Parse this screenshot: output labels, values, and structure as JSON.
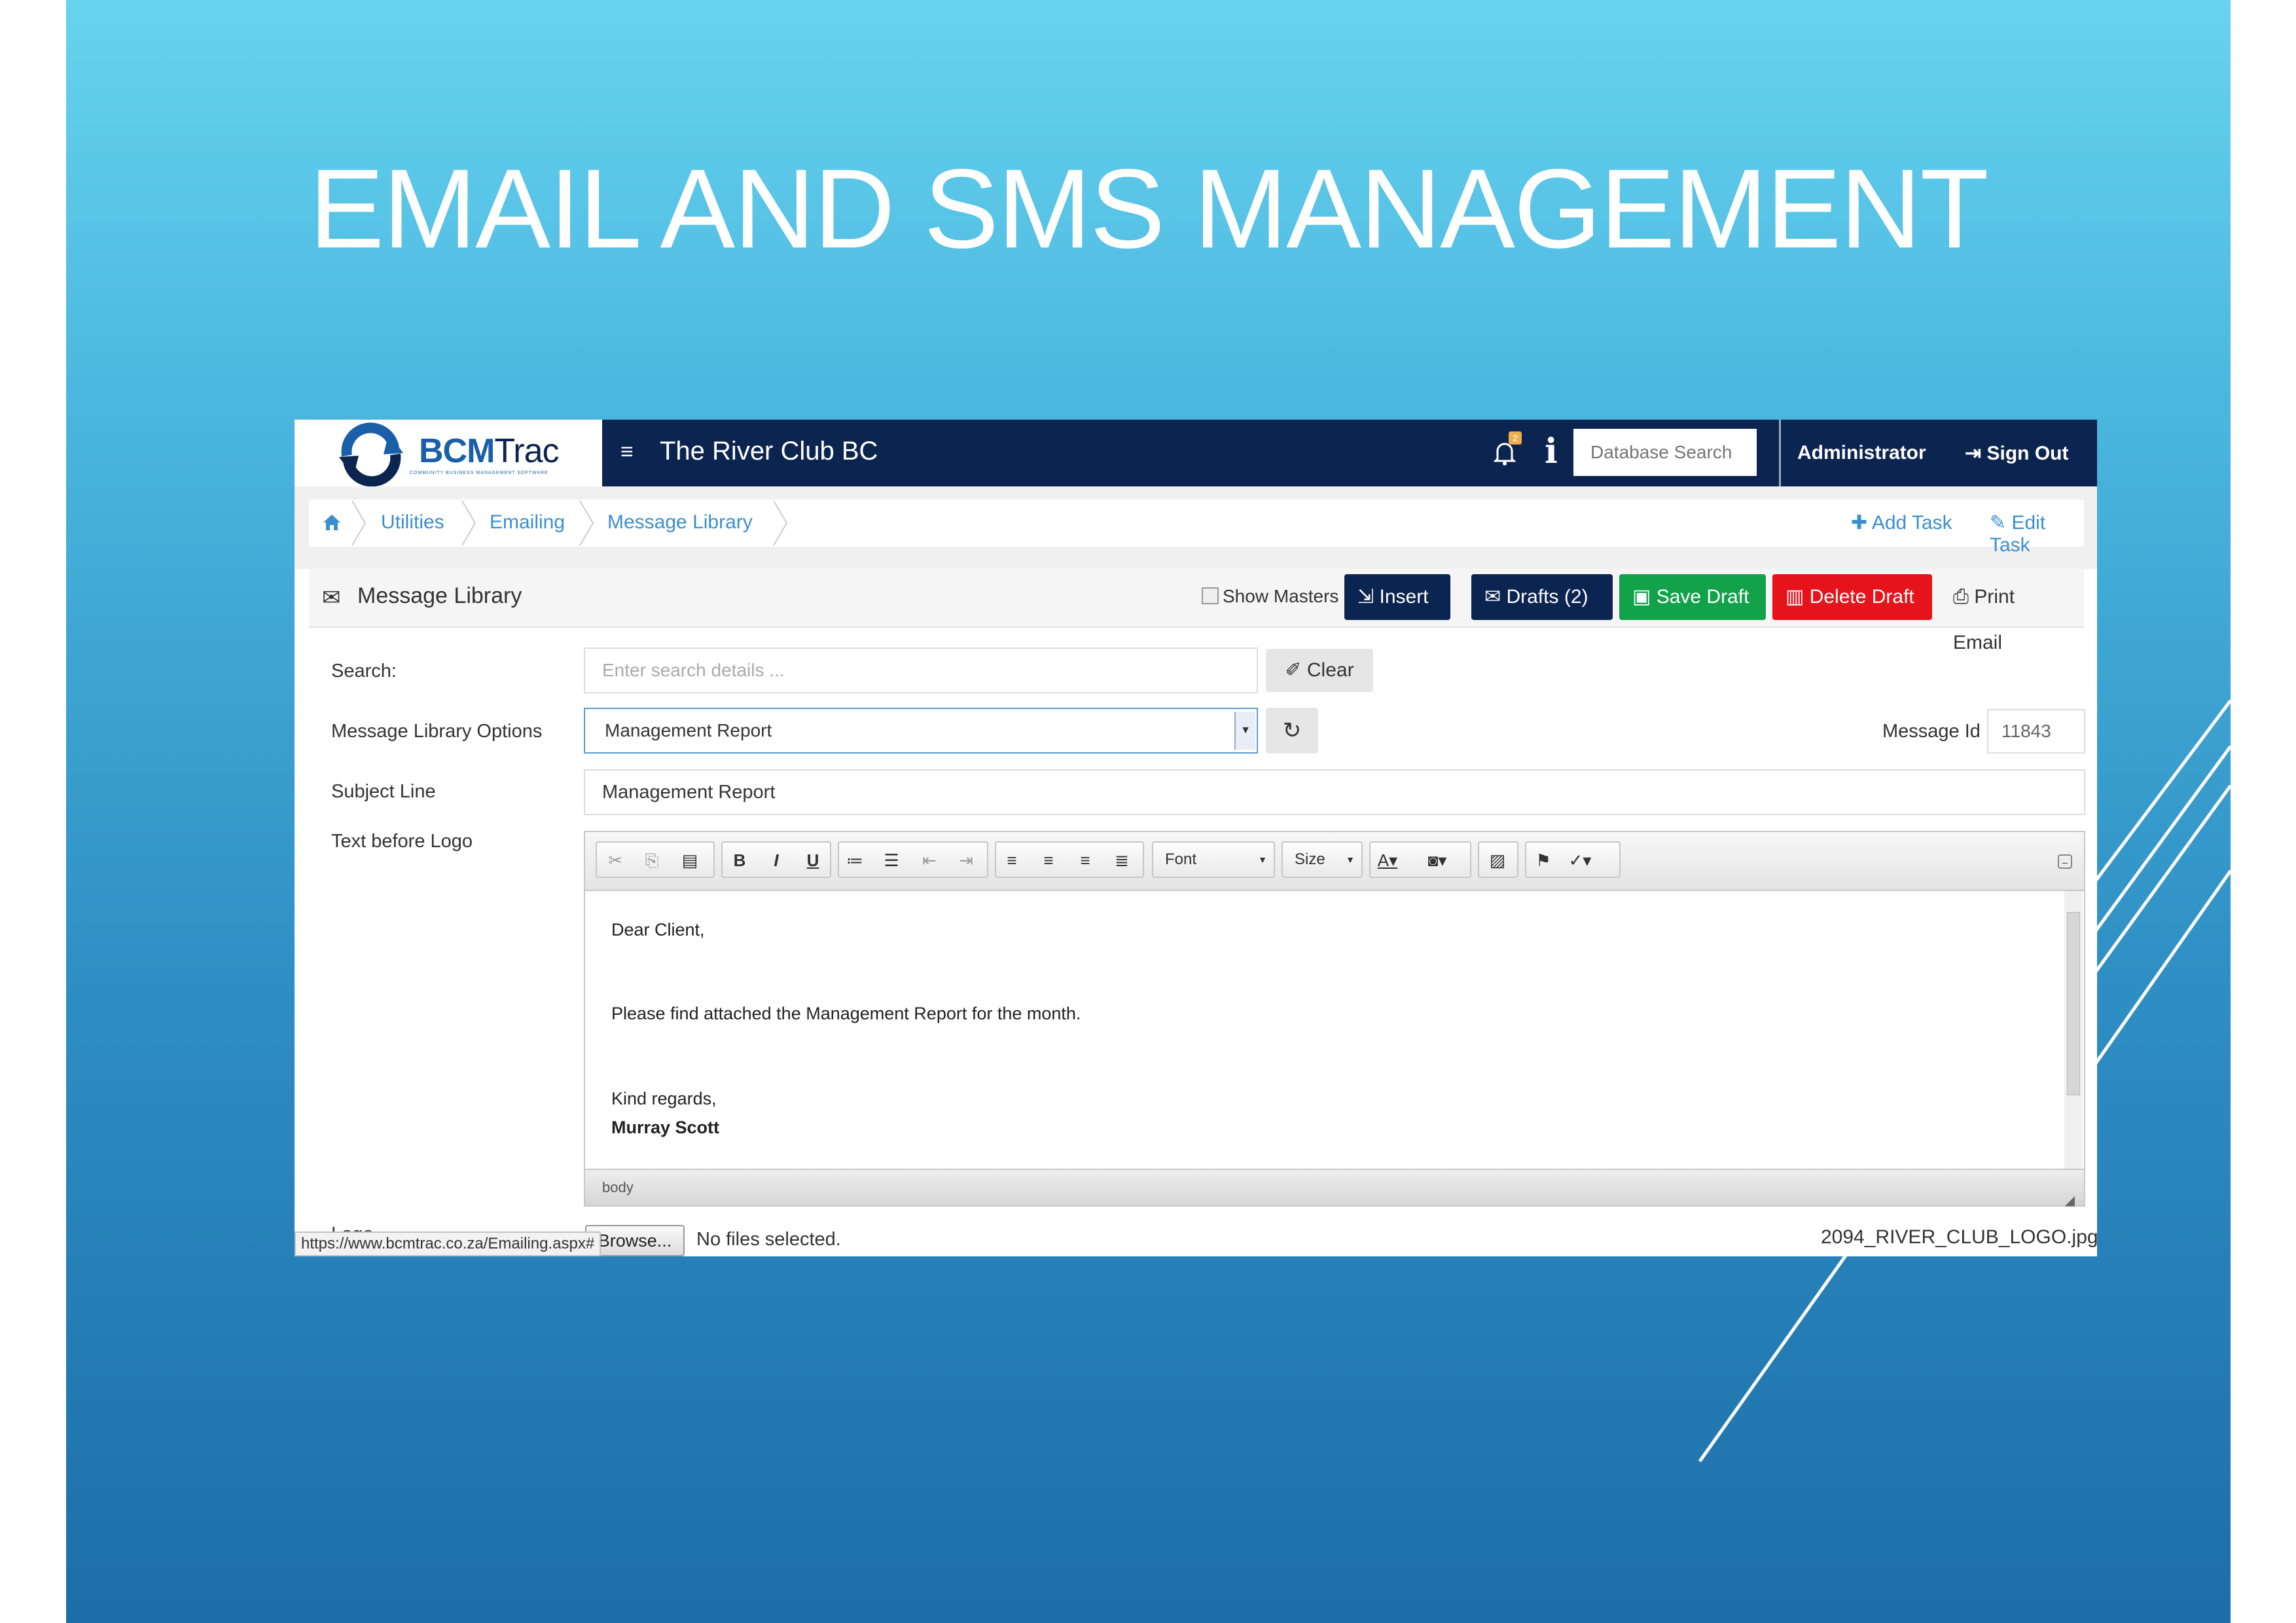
{
  "slide": {
    "title": "EMAIL AND SMS MANAGEMENT"
  },
  "app": {
    "logo_text_bold": "BCM",
    "logo_text_light": "Trac",
    "logo_tagline": "COMMUNITY BUSINESS MANAGEMENT SOFTWARE",
    "club_name": "The River Club BC",
    "notification_count": "2",
    "db_search_placeholder": "Database Search",
    "user": "Administrator",
    "signout_label": "Sign Out"
  },
  "breadcrumb": {
    "items": [
      "Utilities",
      "Emailing",
      "Message Library"
    ],
    "add_task": "Add Task",
    "edit_task": "Edit Task"
  },
  "panel": {
    "title": "Message Library",
    "show_masters": "Show Masters",
    "insert": "Insert",
    "drafts": "Drafts (2)",
    "save_draft": "Save Draft",
    "delete_draft": "Delete Draft",
    "print_email": "Print Email"
  },
  "form": {
    "search_label": "Search:",
    "search_placeholder": "Enter search details ...",
    "clear_label": "Clear",
    "options_label": "Message Library Options",
    "options_value": "Management Report",
    "message_id_label": "Message Id",
    "message_id_value": "11843",
    "subject_label": "Subject Line",
    "subject_value": "Management Report",
    "text_before_logo_label": "Text before Logo",
    "logo_label": "Logo",
    "browse_label": "Browse...",
    "no_file": "No files selected.",
    "logo_file": "2094_RIVER_CLUB_LOGO.jpg"
  },
  "editor": {
    "font_label": "Font",
    "size_label": "Size",
    "body_lines": [
      "Dear Client,",
      "Please find attached the Management Report for the month.",
      "Kind regards,",
      "Murray Scott"
    ],
    "status_path": "body"
  },
  "status_url": "https://www.bcmtrac.co.za/Emailing.aspx#",
  "colors": {
    "nav": "#0c2450",
    "link": "#3a8fd0",
    "save": "#12a24a",
    "delete": "#e6141a"
  }
}
